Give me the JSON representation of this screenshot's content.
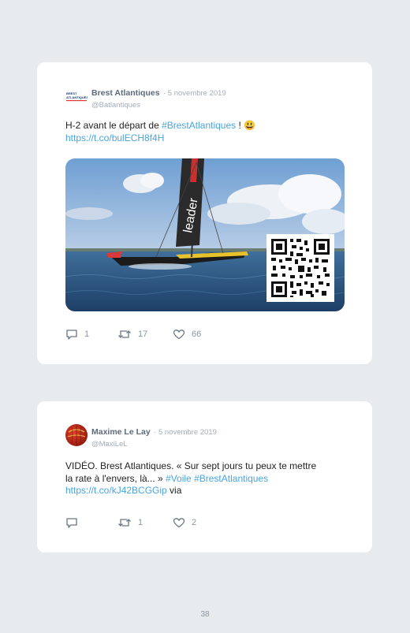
{
  "tweets": [
    {
      "author": "Brest Atlantiques",
      "date": "· 5 novembre 2019",
      "handle": "@Batlantiques",
      "text_before": "H-2 avant le départ de ",
      "hashtag": "#BrestAtlantiques",
      "text_after": " ! 😃",
      "url": "https://t.co/bulECH8f4H",
      "logo_text": "BREST ATLANTIQUES",
      "photo_sail_text": "leader",
      "replies": "1",
      "retweets": "17",
      "likes": "66"
    },
    {
      "author": "Maxime Le Lay",
      "date": "· 5 novembre 2019",
      "handle": "@MaxiLeL",
      "text_line1": "VIDÉO. Brest Atlantiques. « Sur sept jours tu peux te mettre",
      "text_line2_before": "la rate à l'envers, là... » ",
      "hashtag1": "#Voile",
      "hashtag2": "#BrestAtlantiques",
      "url": "https://t.co/kJ42BCGGip",
      "url_suffix": " via",
      "replies": "",
      "retweets": "1",
      "likes": "2"
    }
  ],
  "page_number": "38",
  "colors": {
    "background": "#e8ebee",
    "card": "#ffffff",
    "link": "#4aa4dd",
    "name": "#5d6a7a",
    "muted": "#a3adb8"
  }
}
